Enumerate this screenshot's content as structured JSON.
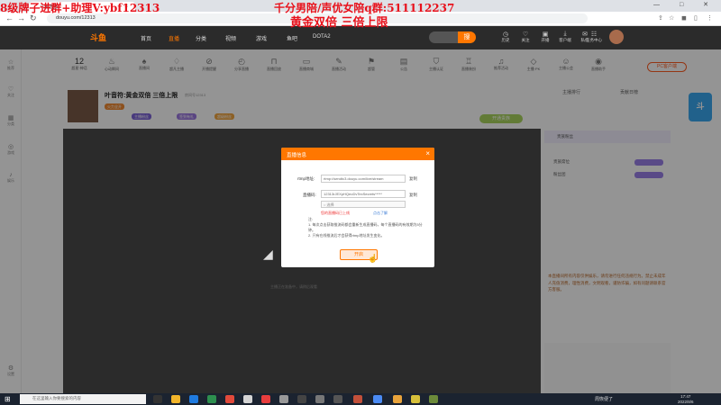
{
  "browser": {
    "tab_title": "斗鱼直播",
    "url": "douyu.com/12313",
    "window_controls": "— □ ✕"
  },
  "overlay": {
    "left_text": "8级牌子进群+助理V:ybf12313",
    "right_text": "千分男陪/声优女陪q群:511112237",
    "center_text": "黄金双倍 三倍上限"
  },
  "site": {
    "logo": "斗鱼",
    "nav": [
      "首页",
      "直播",
      "分类",
      "视频",
      "游戏",
      "鱼吧",
      "DOTA2"
    ],
    "search_button": "搜",
    "header_icons": [
      "历史",
      "关注",
      "开播",
      "客户端",
      "私信",
      "任务中心"
    ]
  },
  "sidebar": {
    "items": [
      "推荐",
      "关注",
      "分类",
      "游戏",
      "娱乐"
    ],
    "bottom_item": "设置"
  },
  "categories": {
    "items": [
      "12",
      "超星·神话",
      "心动瞬间",
      "直播间",
      "超凡主播",
      "开播提醒",
      "分享直播",
      "直播回放",
      "直播商城",
      "直播活动",
      "超管",
      "公告",
      "主播认证",
      "直播装扮",
      "推荐活动",
      "主播·PK",
      "主播公会",
      "直播助手"
    ],
    "pc_button": "PC客户端"
  },
  "room": {
    "title": "叶音符:黄金双倍 三倍上限",
    "sub": "房间号12313",
    "follow_label": "关注",
    "gift_label": "开通贵族",
    "tags": [
      "火力全开",
      "主播粉丝",
      "签到有礼",
      "超级粉丝"
    ]
  },
  "right_panel": {
    "tabs": [
      "主播排行",
      "贡献日榜"
    ],
    "rank_title": "贵族粉丝",
    "rows": [
      "贵族席位",
      "粉丝团"
    ],
    "notice": "本直播间所有内容仅供娱乐，请勿进行任何违规行为。禁止未成年人充值消费，理性消费，文明观看，谨防诈骗，如有问题请联系官方客服。"
  },
  "video": {
    "status_text": "主播正在准备中，请稍后观看"
  },
  "modal": {
    "title": "直播信息",
    "rtmp_label": "rtmp地址:",
    "rtmp_value": "rtmp://sendtc3.douyu.com/live/stream",
    "key_label": "直播码:",
    "key_value": "12313rJEXpHQeoDvTexSecrets*****",
    "copy_label": "复制",
    "select_value": "○ 选择",
    "hint_red": "您的直播码已上线",
    "hint_link": "点击了解",
    "notes": [
      "注:",
      "1. 每次点击获取推流码都会重新生成直播码，每个直播码的有效期为5分钟。",
      "2. 只有在线推流后才会获得rtmp地址发生变化。"
    ],
    "confirm_label": "开启"
  },
  "taskbar": {
    "search_placeholder": "在这里输入你要搜索的内容",
    "weather": "周恢便了",
    "time": "17:47",
    "date": "2022/8/6"
  }
}
